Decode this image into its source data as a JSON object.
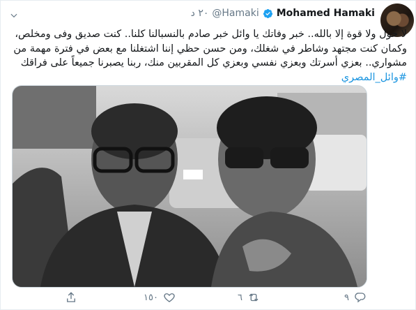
{
  "tweet": {
    "author": {
      "name": "Mohamed Hamaki",
      "handle": "@Hamaki",
      "time": "٢٠ د"
    },
    "text": "لا حول ولا قوة إلا بالله.. خبر وفاتك يا وائل خبر صادم بالنسبالنا كلنا.. كنت صديق وفى ومخلص، وكمان كنت مجتهد وشاطر في شغلك، ومن حسن حظي إننا اشتغلنا مع بعض في فترة مهمة من مشواري.. بعزي أسرتك وبعزي نفسي وبعزي كل المقربين منك، ربنا يصبرنا جميعاً على فراقك",
    "hashtag": "#وائل_المصري",
    "stats": {
      "replies": "٩",
      "retweets": "٦",
      "likes": "١٥٠"
    }
  },
  "colors": {
    "link": "#1b95e0",
    "muted": "#657786",
    "verified": "#1da1f2"
  },
  "icons": [
    "verified-badge-icon",
    "chevron-down-icon",
    "reply-icon",
    "retweet-icon",
    "like-icon",
    "share-icon"
  ]
}
